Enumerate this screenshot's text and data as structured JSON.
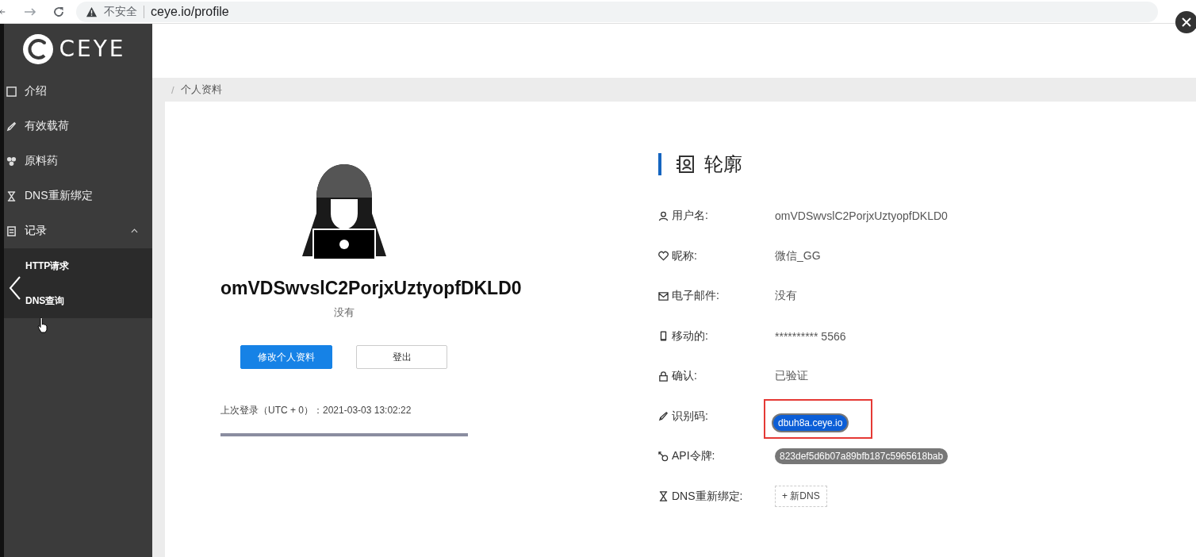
{
  "browser": {
    "security": "不安全",
    "url": "ceye.io/profile"
  },
  "sidebar": {
    "logo": "CEYE",
    "items": [
      {
        "label": "介绍"
      },
      {
        "label": "有效载荷"
      },
      {
        "label": "原料药"
      },
      {
        "label": "DNS重新绑定"
      },
      {
        "label": "记录",
        "expanded": true,
        "children": [
          {
            "label": "HTTP请求"
          },
          {
            "label": "DNS查询"
          }
        ]
      }
    ]
  },
  "breadcrumb": {
    "separator": "/",
    "current": "个人资料"
  },
  "profile": {
    "name": "omVDSwvslC2PorjxUztyopfDKLD0",
    "email": "没有",
    "buttons": [
      {
        "label": "修改个人资料",
        "kind": "primary"
      },
      {
        "label": "登出",
        "kind": "default"
      }
    ],
    "last_login": "上次登录（UTC + 0）：2021-03-03 13:02:22"
  },
  "details": {
    "title": "轮廓",
    "rows": [
      {
        "label": "用户名:",
        "value": "omVDSwvslC2PorjxUztyopfDKLD0",
        "kind": "text",
        "selected": false,
        "highlighted": false
      },
      {
        "label": "昵称:",
        "value": "微信_GG",
        "kind": "text",
        "selected": false,
        "highlighted": false
      },
      {
        "label": "电子邮件:",
        "value": "没有",
        "kind": "text",
        "selected": false,
        "highlighted": false
      },
      {
        "label": "移动的:",
        "value": "********** 5566",
        "kind": "text",
        "selected": false,
        "highlighted": false
      },
      {
        "label": "确认:",
        "value": "已验证",
        "kind": "text",
        "selected": false,
        "highlighted": false
      },
      {
        "label": "识别码:",
        "value": "dbuh8a.ceye.io",
        "kind": "tag",
        "selected": true,
        "highlighted": true
      },
      {
        "label": "API令牌:",
        "value": "823def5d6b07a89bfb187c5965618bab",
        "kind": "tag",
        "selected": false,
        "highlighted": false
      },
      {
        "label": "DNS重新绑定:",
        "value": "+ 新DNS",
        "kind": "add",
        "selected": false,
        "highlighted": false
      }
    ]
  }
}
